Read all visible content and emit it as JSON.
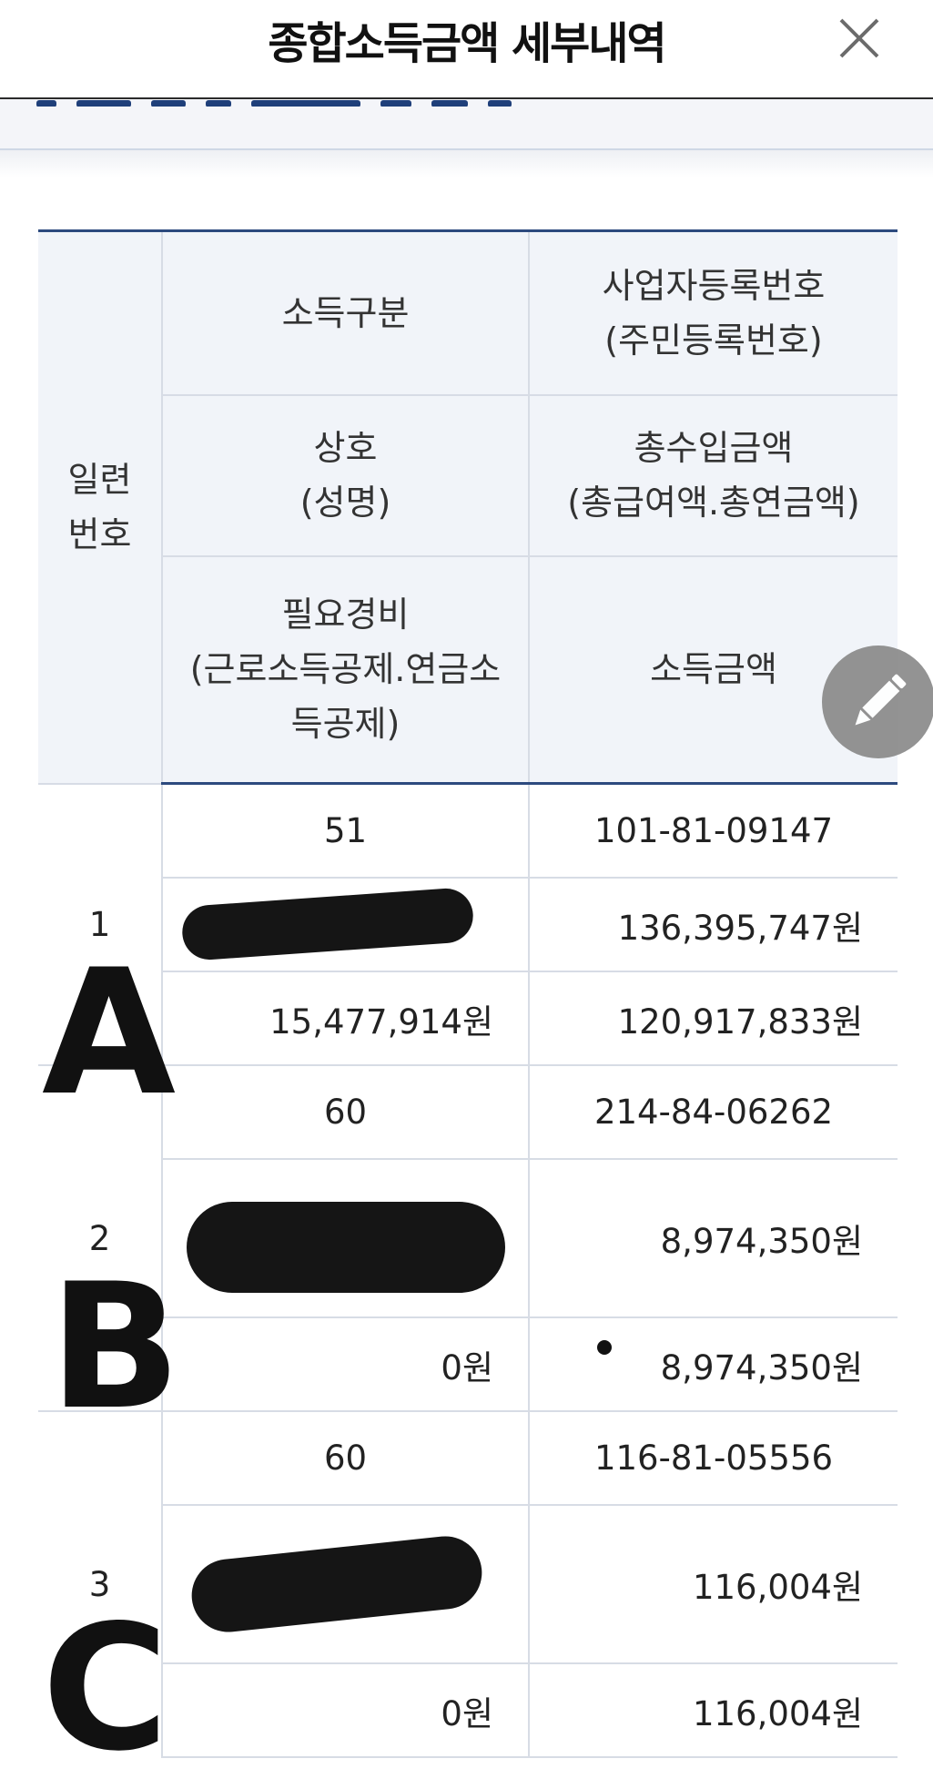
{
  "header": {
    "title": "종합소득금액 세부내역",
    "close_icon": "close-icon"
  },
  "table": {
    "headers": {
      "seq": "일련\n번호",
      "income_type": "소득구분",
      "business_no": "사업자등록번호\n(주민등록번호)",
      "company_name": "상호\n(성명)",
      "total_income": "총수입금액\n(총급여액.총연금액)",
      "expenses": "필요경비\n(근로소득공제.연금소\n득공제)",
      "income_amount": "소득금액"
    },
    "rows": [
      {
        "seq": "1",
        "income_type": "51",
        "business_no": "101-81-09147",
        "company_name": "",
        "total_income": "136,395,747원",
        "expenses": "15,477,914원",
        "income_amount": "120,917,833원"
      },
      {
        "seq": "2",
        "income_type": "60",
        "business_no": "214-84-06262",
        "company_name": "",
        "total_income": "8,974,350원",
        "expenses": "0원",
        "income_amount": "8,974,350원"
      },
      {
        "seq": "3",
        "income_type": "60",
        "business_no": "116-81-05556",
        "company_name": "",
        "total_income": "116,004원",
        "expenses": "0원",
        "income_amount": "116,004원"
      }
    ]
  },
  "annotations": {
    "letters": [
      "A",
      "B",
      "C"
    ]
  },
  "fab": {
    "icon": "pencil-icon"
  }
}
